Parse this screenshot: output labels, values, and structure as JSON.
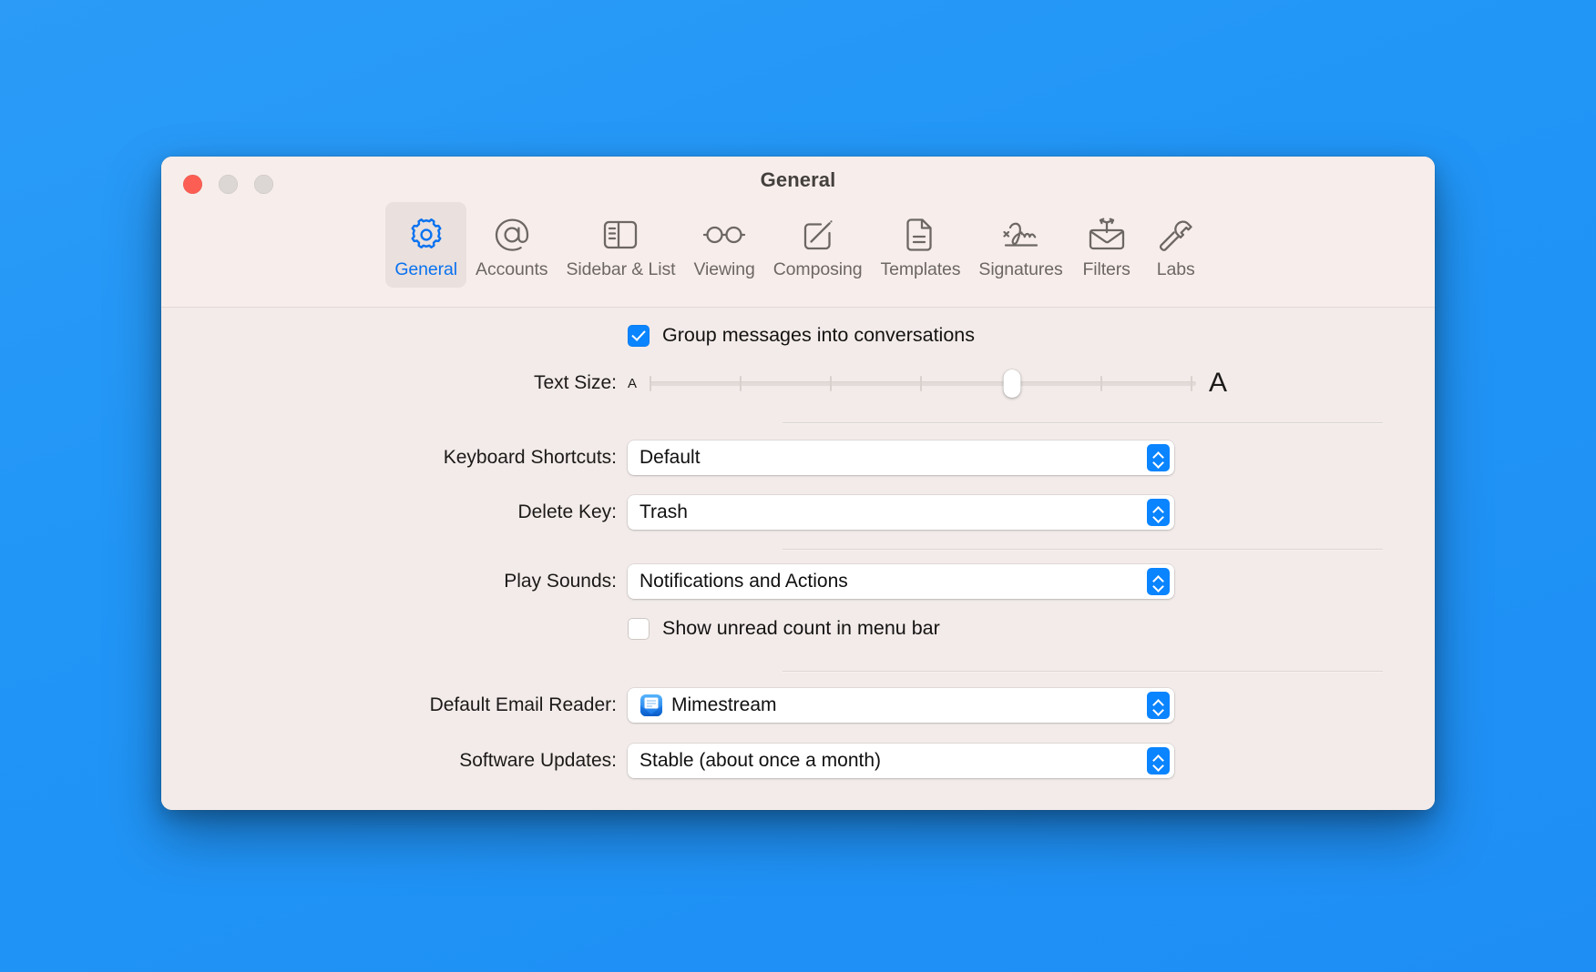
{
  "window": {
    "title": "General",
    "traffic_lights": [
      "close",
      "minimize",
      "maximize"
    ]
  },
  "toolbar": {
    "tabs": [
      {
        "label": "General",
        "icon": "gear-icon",
        "selected": true
      },
      {
        "label": "Accounts",
        "icon": "at-sign-icon",
        "selected": false
      },
      {
        "label": "Sidebar & List",
        "icon": "sidebar-icon",
        "selected": false
      },
      {
        "label": "Viewing",
        "icon": "glasses-icon",
        "selected": false
      },
      {
        "label": "Composing",
        "icon": "compose-icon",
        "selected": false
      },
      {
        "label": "Templates",
        "icon": "document-icon",
        "selected": false
      },
      {
        "label": "Signatures",
        "icon": "signature-icon",
        "selected": false
      },
      {
        "label": "Filters",
        "icon": "mail-filter-icon",
        "selected": false
      },
      {
        "label": "Labs",
        "icon": "hammer-icon",
        "selected": false
      }
    ]
  },
  "general": {
    "group_messages": {
      "label": "Group messages into conversations",
      "checked": true
    },
    "text_size": {
      "label": "Text Size:",
      "min_glyph": "A",
      "max_glyph": "A",
      "ticks": 7,
      "value": 5
    },
    "keyboard_shortcuts": {
      "label": "Keyboard Shortcuts:",
      "value": "Default"
    },
    "delete_key": {
      "label": "Delete Key:",
      "value": "Trash"
    },
    "play_sounds": {
      "label": "Play Sounds:",
      "value": "Notifications and Actions"
    },
    "show_unread_count": {
      "label": "Show unread count in menu bar",
      "checked": false
    },
    "default_email_reader": {
      "label": "Default Email Reader:",
      "value": "Mimestream",
      "icon": "mimestream-app-icon"
    },
    "software_updates": {
      "label": "Software Updates:",
      "value": "Stable (about once a month)"
    }
  },
  "colors": {
    "accent": "#0a84ff",
    "selected_tab_text": "#0a72f0",
    "window_bg": "#f2ebe9",
    "toolbar_bg": "#f7eeeb",
    "desktop": "#2196f7",
    "close_button": "#fd5e53"
  }
}
